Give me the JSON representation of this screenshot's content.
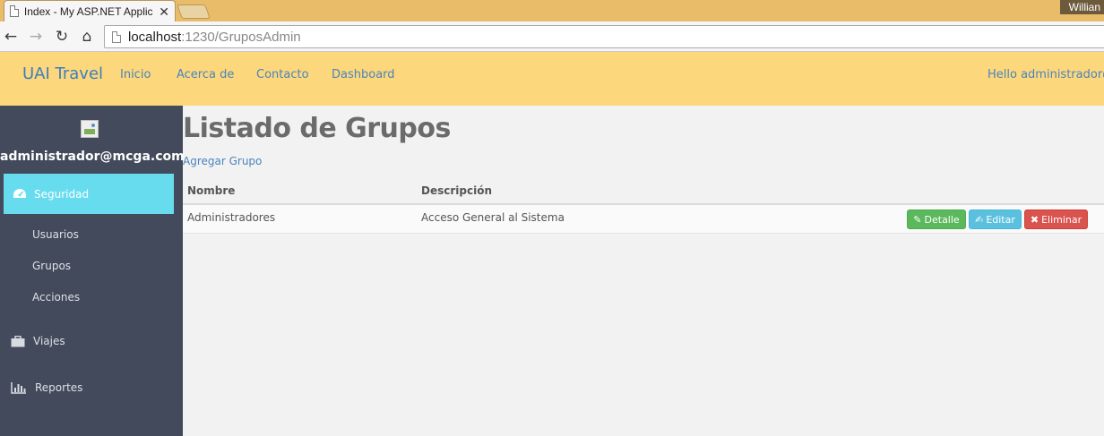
{
  "browser": {
    "tab_title": "Index - My ASP.NET Applic",
    "tab_close": "✕",
    "user_chip": "Willian",
    "url_host": "localhost",
    "url_rest": ":1230/GruposAdmin",
    "icons": {
      "back": "arrow-left-icon",
      "forward": "arrow-right-icon",
      "reload": "reload-icon",
      "home": "home-icon",
      "page": "document-icon"
    }
  },
  "navbar": {
    "brand": "UAI Travel",
    "links": [
      "Inicio",
      "Acerca de",
      "Contacto",
      "Dashboard"
    ],
    "hello": "Hello administrador@",
    "background": "#fdd77b",
    "link_color": "#4a84bd"
  },
  "sidebar": {
    "user": "administrador@mcga.com",
    "active_item": {
      "label": "Seguridad",
      "icon": "dashboard-icon"
    },
    "sub_items": [
      "Usuarios",
      "Grupos",
      "Acciones"
    ],
    "items": [
      {
        "label": "Viajes",
        "icon": "briefcase-icon"
      },
      {
        "label": "Reportes",
        "icon": "bar-chart-icon"
      }
    ],
    "background": "#424a5c",
    "active_color": "#67dcef"
  },
  "main": {
    "title": "Listado de Grupos",
    "add_link": "Agregar Grupo",
    "table": {
      "headers": [
        "Nombre",
        "Descripción"
      ],
      "rows": [
        {
          "nombre": "Administradores",
          "descripcion": "Acceso General al Sistema",
          "actions": {
            "detail": "Detalle",
            "edit": "Editar",
            "delete": "Eliminar"
          }
        }
      ]
    }
  }
}
